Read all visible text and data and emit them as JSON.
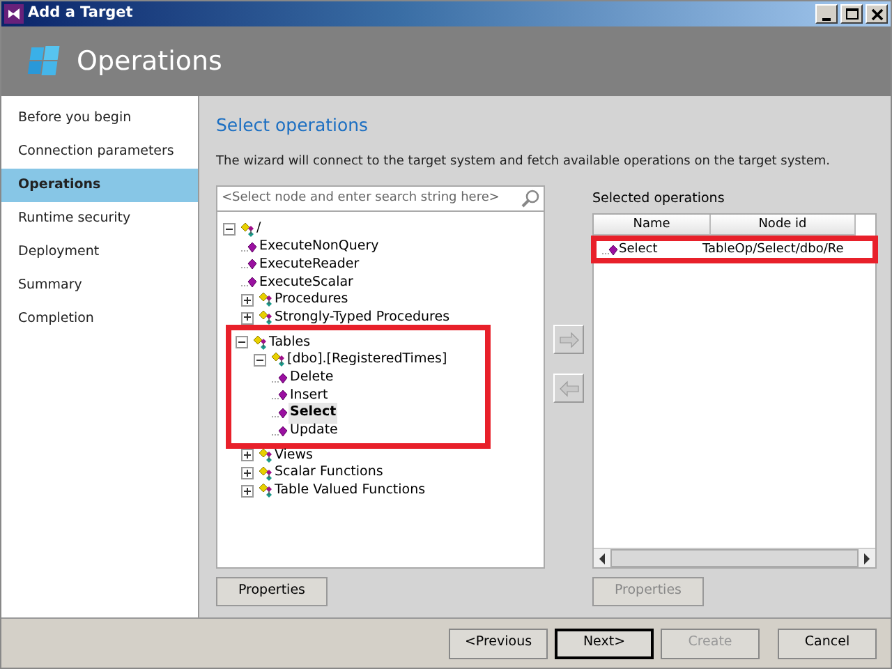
{
  "window": {
    "title": "Add a Target"
  },
  "header": {
    "title": "Operations"
  },
  "steps": [
    {
      "label": "Before you begin",
      "selected": false
    },
    {
      "label": "Connection parameters",
      "selected": false
    },
    {
      "label": "Operations",
      "selected": true
    },
    {
      "label": "Runtime security",
      "selected": false
    },
    {
      "label": "Deployment",
      "selected": false
    },
    {
      "label": "Summary",
      "selected": false
    },
    {
      "label": "Completion",
      "selected": false
    }
  ],
  "page": {
    "heading": "Select operations",
    "description": "The wizard will connect to the target system and fetch available operations on the target system."
  },
  "search": {
    "placeholder": "<Select node and enter search string here>"
  },
  "tree": [
    {
      "label": "/",
      "kind": "folder",
      "expanded": true,
      "selected": false,
      "highlighted": false,
      "children": [
        {
          "label": "ExecuteNonQuery",
          "kind": "operation",
          "selected": false,
          "highlighted": false
        },
        {
          "label": "ExecuteReader",
          "kind": "operation",
          "selected": false,
          "highlighted": false
        },
        {
          "label": "ExecuteScalar",
          "kind": "operation",
          "selected": false,
          "highlighted": false
        },
        {
          "label": "Procedures",
          "kind": "folder",
          "expanded": false,
          "selected": false,
          "highlighted": false
        },
        {
          "label": "Strongly-Typed Procedures",
          "kind": "folder",
          "expanded": false,
          "selected": false,
          "highlighted": false
        },
        {
          "label": "Tables",
          "kind": "folder",
          "expanded": true,
          "selected": false,
          "highlighted": true,
          "children": [
            {
              "label": "[dbo].[RegisteredTimes]",
              "kind": "folder",
              "expanded": true,
              "selected": false,
              "highlighted": false,
              "children": [
                {
                  "label": "Delete",
                  "kind": "operation",
                  "selected": false,
                  "highlighted": false
                },
                {
                  "label": "Insert",
                  "kind": "operation",
                  "selected": false,
                  "highlighted": false
                },
                {
                  "label": "Select",
                  "kind": "operation",
                  "selected": true,
                  "highlighted": false
                },
                {
                  "label": "Update",
                  "kind": "operation",
                  "selected": false,
                  "highlighted": false
                }
              ]
            }
          ]
        },
        {
          "label": "Views",
          "kind": "folder",
          "expanded": false,
          "selected": false,
          "highlighted": false
        },
        {
          "label": "Scalar Functions",
          "kind": "folder",
          "expanded": false,
          "selected": false,
          "highlighted": false
        },
        {
          "label": "Table Valued Functions",
          "kind": "folder",
          "expanded": false,
          "selected": false,
          "highlighted": false
        }
      ]
    }
  ],
  "transfer_buttons": [
    {
      "kind": "add",
      "disabled": true
    },
    {
      "kind": "remove",
      "disabled": true
    }
  ],
  "selected_operations": {
    "label": "Selected operations",
    "columns": [
      "Name",
      "Node id"
    ],
    "rows": [
      {
        "name": "Select",
        "node_id": "TableOp/Select/dbo/Re",
        "highlighted": true
      }
    ]
  },
  "properties_buttons": [
    {
      "label": "Properties",
      "disabled": false
    },
    {
      "label": "Properties",
      "disabled": true
    }
  ],
  "footer_buttons": [
    {
      "label": "<Previous",
      "disabled": false,
      "default": false
    },
    {
      "label": "Next>",
      "disabled": false,
      "default": true
    },
    {
      "label": "Create",
      "disabled": true,
      "default": false
    },
    {
      "label": "Cancel",
      "disabled": false,
      "default": false
    }
  ]
}
